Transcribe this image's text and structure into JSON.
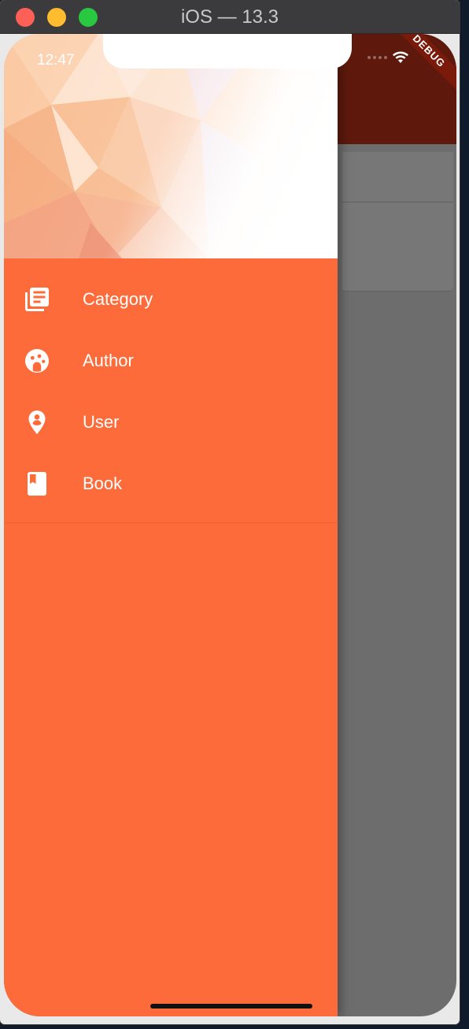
{
  "window": {
    "title": "iOS — 13.3"
  },
  "status_bar": {
    "time": "12:47"
  },
  "debug_banner": {
    "label": "DEBUG"
  },
  "drawer": {
    "items": [
      {
        "label": "Category",
        "icon": "library-books-icon"
      },
      {
        "label": "Author",
        "icon": "author-face-icon"
      },
      {
        "label": "User",
        "icon": "user-pin-icon"
      },
      {
        "label": "Book",
        "icon": "book-icon"
      }
    ]
  },
  "colors": {
    "drawer_background": "#fe6b3a",
    "app_bar": "#5e190c",
    "scrim": "#6d6d6d"
  }
}
